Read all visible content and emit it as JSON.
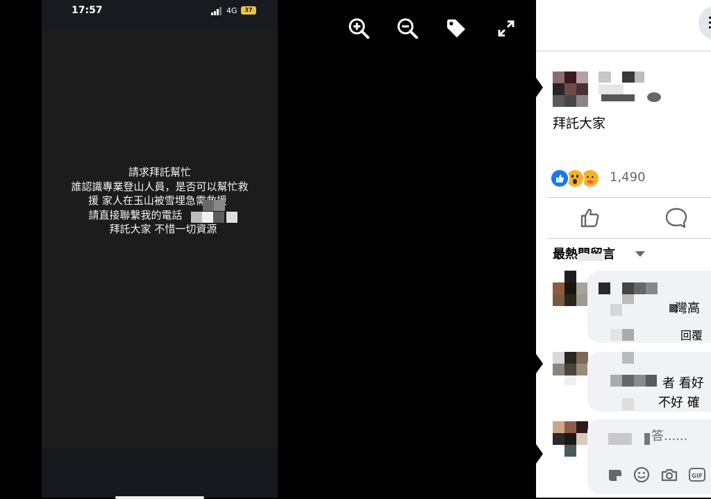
{
  "phone": {
    "time": "17:57",
    "network": "4G",
    "battery": "37"
  },
  "story": {
    "lines": [
      "請求拜託幫忙",
      "誰認識專業登山人員，是否可以幫忙救",
      "援 家人在玉山被雪埋急需救援",
      "請直接聯繫我的電話",
      "拜託大家 不惜一切資源"
    ]
  },
  "viewer_controls": {
    "icons": [
      "zoom-in-icon",
      "zoom-out-icon",
      "tag-icon",
      "fullscreen-icon"
    ]
  },
  "post": {
    "text": "拜託大家",
    "reactions": [
      "like",
      "wow",
      "care"
    ],
    "reaction_count": "1,490"
  },
  "actions": {
    "icons": [
      "like-icon",
      "comment-icon"
    ]
  },
  "comments": {
    "sort_label": "最熱門留言",
    "comment1_fragment": "灣高",
    "reply_label": "回覆",
    "comment2_fragment_a": "者 看好",
    "comment2_fragment_b": "不好 確",
    "reply_placeholder": "答......",
    "tools": [
      "sticker-icon",
      "emoji-icon",
      "camera-icon",
      "gif-icon"
    ],
    "gif_label": "GIF"
  },
  "colors": {
    "like_blue": "#1877f2",
    "wow_yellow": "#f7b125",
    "panel_bg": "#ffffff",
    "bubble_bg": "#f0f2f5"
  }
}
